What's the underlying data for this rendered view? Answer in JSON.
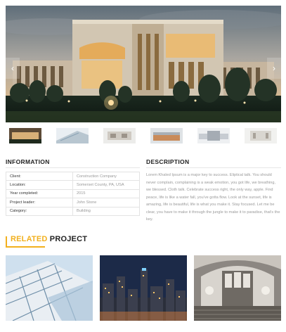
{
  "slider": {
    "prev_icon": "chevron-left-icon",
    "next_icon": "chevron-right-icon",
    "prev_glyph": "‹",
    "next_glyph": "›"
  },
  "info": {
    "heading": "INFORMATION",
    "rows": [
      {
        "label": "Client:",
        "value": "Construction Company"
      },
      {
        "label": "Location:",
        "value": "Somerset County, PA, USA"
      },
      {
        "label": "Year completed:",
        "value": "2015"
      },
      {
        "label": "Project leader:",
        "value": "John Stone"
      },
      {
        "label": "Category:",
        "value": "Building"
      }
    ]
  },
  "description": {
    "heading": "DESCRIPTION",
    "text": "Lorem Khaled Ipsum is a major key to success. Eliptical talk. You should never complain, complaining is a weak emotion, you got life, we breathing, we blessed. Cloth talk. Celebrate success right, the only way, apple. Find peace, life is like a water fall, you've gotta flow. Look at the sunset, life is amazing, life is beautiful, life is what you make it. Stay focused. Let me be clear, you have to make it through the jungle to make it to paradise, that's the key."
  },
  "related": {
    "highlight": "RELATED",
    "rest": " PROJECT",
    "accent": "#f2b01e"
  }
}
